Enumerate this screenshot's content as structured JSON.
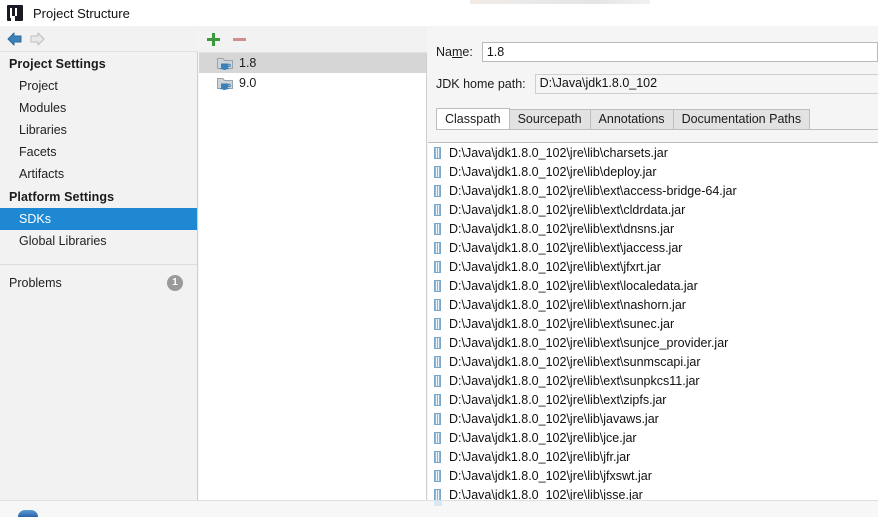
{
  "window": {
    "title": "Project Structure",
    "app_icon": "intellij-idea-logo-icon"
  },
  "navbar": {
    "back_icon": "arrow-left-icon",
    "forward_icon": "arrow-right-icon",
    "back_enabled": "true",
    "forward_enabled": "false"
  },
  "sidebar": {
    "groups": [
      {
        "label": "Project Settings",
        "items": [
          {
            "label": "Project",
            "selected": false
          },
          {
            "label": "Modules",
            "selected": false
          },
          {
            "label": "Libraries",
            "selected": false
          },
          {
            "label": "Facets",
            "selected": false
          },
          {
            "label": "Artifacts",
            "selected": false
          }
        ]
      },
      {
        "label": "Platform Settings",
        "items": [
          {
            "label": "SDKs",
            "selected": true
          },
          {
            "label": "Global Libraries",
            "selected": false
          }
        ]
      }
    ],
    "problems": {
      "label": "Problems",
      "badge_count": "1"
    }
  },
  "sdk_panel": {
    "toolbar": {
      "add_label": "+",
      "add_icon": "plus-icon",
      "remove_label": "−",
      "remove_icon": "minus-icon"
    },
    "items": [
      {
        "label": "1.8",
        "icon": "jdk-folder-icon",
        "selected": true
      },
      {
        "label": "9.0",
        "icon": "jdk-folder-icon",
        "selected": false
      }
    ]
  },
  "detail": {
    "name_label_pre": "Na",
    "name_label_mnemonic": "m",
    "name_label_post": "e:",
    "name_value": "1.8",
    "name_placeholder": "",
    "home_path_label": "JDK home path:",
    "home_path_value": "D:\\Java\\jdk1.8.0_102",
    "tabs": [
      {
        "label": "Classpath",
        "active": true
      },
      {
        "label": "Sourcepath",
        "active": false
      },
      {
        "label": "Annotations",
        "active": false
      },
      {
        "label": "Documentation Paths",
        "active": false
      }
    ],
    "classpath_entries": [
      "D:\\Java\\jdk1.8.0_102\\jre\\lib\\charsets.jar",
      "D:\\Java\\jdk1.8.0_102\\jre\\lib\\deploy.jar",
      "D:\\Java\\jdk1.8.0_102\\jre\\lib\\ext\\access-bridge-64.jar",
      "D:\\Java\\jdk1.8.0_102\\jre\\lib\\ext\\cldrdata.jar",
      "D:\\Java\\jdk1.8.0_102\\jre\\lib\\ext\\dnsns.jar",
      "D:\\Java\\jdk1.8.0_102\\jre\\lib\\ext\\jaccess.jar",
      "D:\\Java\\jdk1.8.0_102\\jre\\lib\\ext\\jfxrt.jar",
      "D:\\Java\\jdk1.8.0_102\\jre\\lib\\ext\\localedata.jar",
      "D:\\Java\\jdk1.8.0_102\\jre\\lib\\ext\\nashorn.jar",
      "D:\\Java\\jdk1.8.0_102\\jre\\lib\\ext\\sunec.jar",
      "D:\\Java\\jdk1.8.0_102\\jre\\lib\\ext\\sunjce_provider.jar",
      "D:\\Java\\jdk1.8.0_102\\jre\\lib\\ext\\sunmscapi.jar",
      "D:\\Java\\jdk1.8.0_102\\jre\\lib\\ext\\sunpkcs11.jar",
      "D:\\Java\\jdk1.8.0_102\\jre\\lib\\ext\\zipfs.jar",
      "D:\\Java\\jdk1.8.0_102\\jre\\lib\\javaws.jar",
      "D:\\Java\\jdk1.8.0_102\\jre\\lib\\jce.jar",
      "D:\\Java\\jdk1.8.0_102\\jre\\lib\\jfr.jar",
      "D:\\Java\\jdk1.8.0_102\\jre\\lib\\jfxswt.jar",
      "D:\\Java\\jdk1.8.0_102\\jre\\lib\\jsse.jar"
    ]
  },
  "colors": {
    "selection_blue": "#1e88d3",
    "list_selection_gray": "#d6d6d6",
    "panel_bg": "#f2f2f2",
    "add_green": "#3c9a3c",
    "remove_red": "#c36b6b",
    "badge_gray": "#9a9a9a"
  }
}
